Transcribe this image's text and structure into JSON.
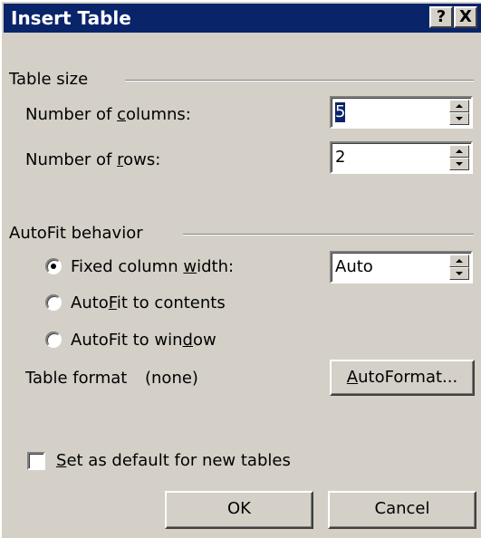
{
  "window": {
    "title": "Insert Table",
    "help_button": "?",
    "close_button": "X",
    "title_bar_color": "#0a246a",
    "face_color": "#d4d0c8"
  },
  "table_size": {
    "group_label": "Table size",
    "columns_label": {
      "pre": "Number of ",
      "key": "c",
      "post": "olumns:"
    },
    "columns_value": "5",
    "rows_label": {
      "pre": "Number of ",
      "key": "r",
      "post": "ows:"
    },
    "rows_value": "2"
  },
  "autofit": {
    "group_label": "AutoFit behavior",
    "fixed": {
      "pre": "Fixed column ",
      "key": "w",
      "post": "idth:",
      "selected": true
    },
    "fixed_value": "Auto",
    "contents": {
      "pre": "Auto",
      "key": "F",
      "post": "it to contents",
      "selected": false
    },
    "window": {
      "pre": "AutoFit to win",
      "key": "d",
      "post": "ow",
      "selected": false
    }
  },
  "table_format": {
    "label": "Table format",
    "value": "(none)",
    "button": {
      "key": "A",
      "post": "utoFormat..."
    }
  },
  "default_checkbox": {
    "key": "S",
    "post": "et as default for new tables",
    "checked": false
  },
  "buttons": {
    "ok": "OK",
    "cancel": "Cancel"
  }
}
